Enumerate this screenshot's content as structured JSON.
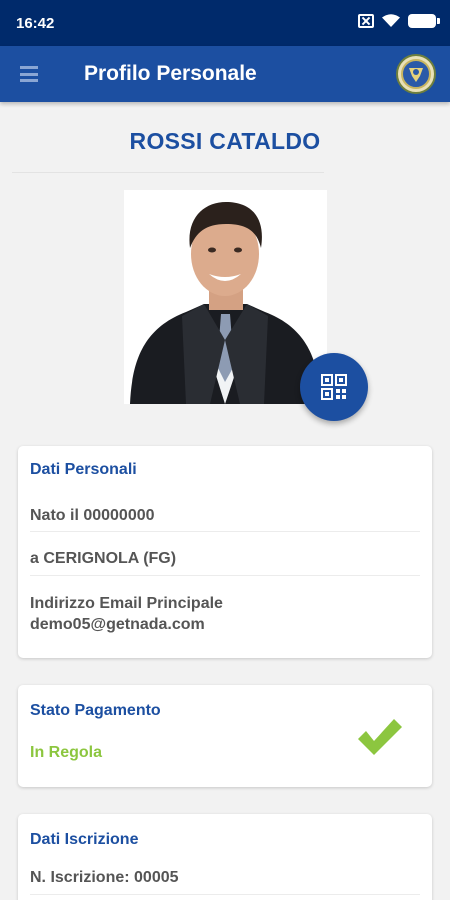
{
  "status_bar": {
    "time": "16:42"
  },
  "app_bar": {
    "title": "Profilo Personale"
  },
  "profile": {
    "name": "ROSSI CATALDO"
  },
  "personal": {
    "title": "Dati Personali",
    "birth": "Nato il 00000000",
    "place": "a CERIGNOLA (FG)",
    "email_label": "Indirizzo Email Principale",
    "email": "demo05@getnada.com"
  },
  "payment": {
    "title": "Stato Pagamento",
    "status": "In Regola",
    "status_color": "#8cc63f"
  },
  "registration": {
    "title": "Dati Iscrizione",
    "number": "N. Iscrizione: 00005"
  },
  "colors": {
    "status_bar": "#002a6b",
    "app_bar": "#1c4fa1",
    "accent": "#1c4fa1",
    "background": "#f2f2f2"
  }
}
